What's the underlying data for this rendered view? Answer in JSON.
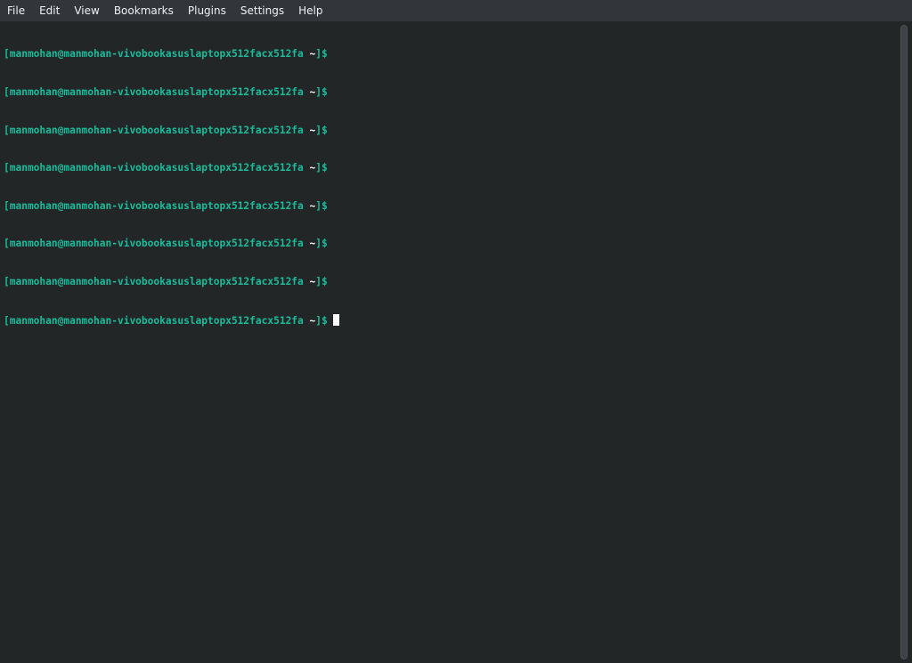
{
  "menubar": {
    "items": [
      "File",
      "Edit",
      "View",
      "Bookmarks",
      "Plugins",
      "Settings",
      "Help"
    ]
  },
  "terminal": {
    "prompt": {
      "user_host": "[manmohan@manmohan-vivobookasuslaptopx512facx512fa",
      "dir": " ~",
      "end": "]$"
    },
    "line_count": 8
  },
  "colors": {
    "background": "#232627",
    "menubar": "#31363b",
    "prompt_green": "#1abc9c",
    "text_white": "#fcfcfc"
  }
}
